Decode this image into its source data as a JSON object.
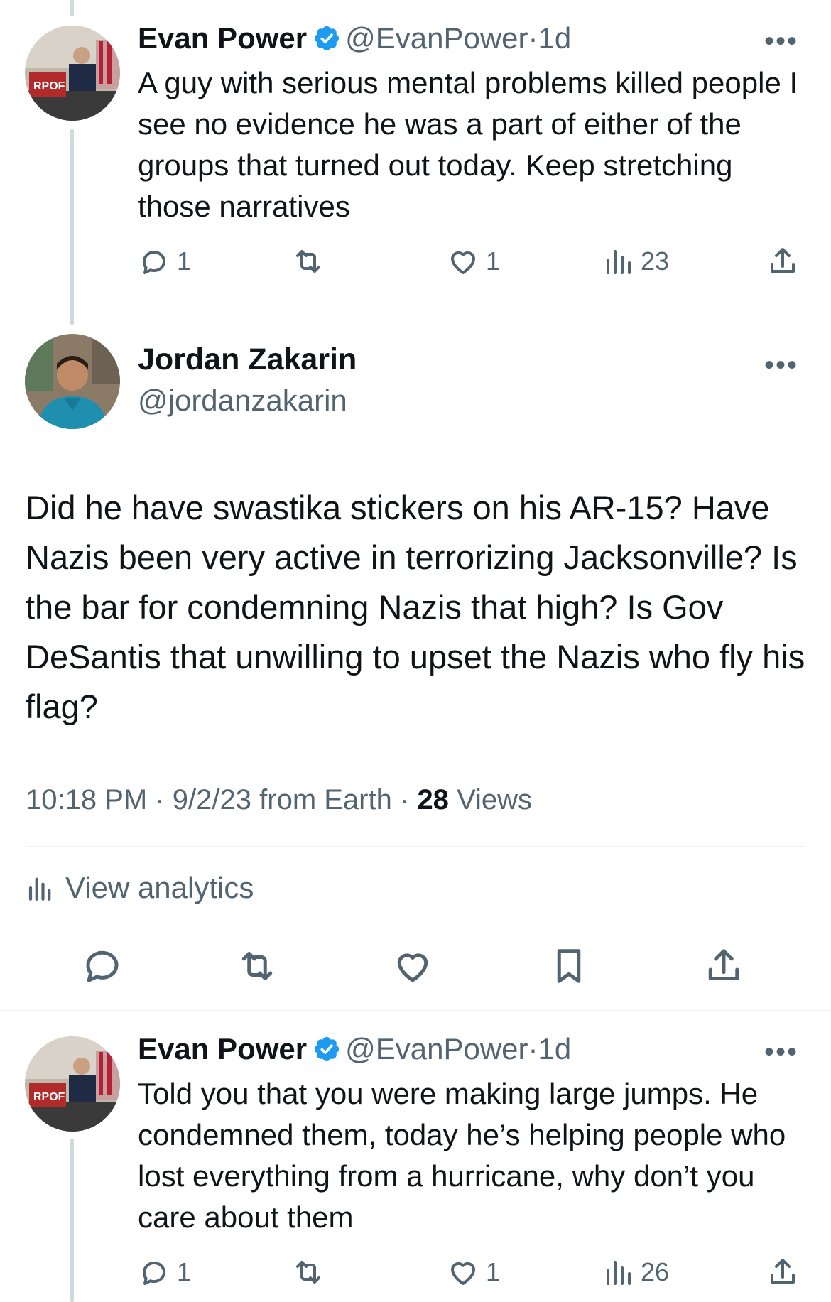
{
  "tweet1": {
    "name": "Evan Power",
    "handle": "@EvanPower",
    "separator": "·",
    "time": "1d",
    "text": "A guy with serious mental problems killed people I see no evidence he was a part of either of the groups that turned out today. Keep stretching those narratives",
    "replies": "1",
    "likes": "1",
    "views": "23"
  },
  "main_tweet": {
    "name": "Jordan Zakarin",
    "handle": "@jordanzakarin",
    "text": "Did he have swastika stickers on his AR-15? Have Nazis been very active in terrorizing Jacksonville? Is the bar for condemning Nazis that high? Is Gov DeSantis that unwilling to upset the Nazis who fly his flag?",
    "time": "10:18 PM",
    "date": "9/2/23",
    "source": "from Earth",
    "views_count": "28",
    "views_label": "Views",
    "separator": "·",
    "analytics_label": "View analytics"
  },
  "tweet2": {
    "name": "Evan Power",
    "handle": "@EvanPower",
    "separator": "·",
    "time": "1d",
    "text": "Told you that you were making large jumps. He condemned them, today he’s helping people who lost everything from a hurricane, why don’t you care about them",
    "replies": "1",
    "likes": "1",
    "views": "26"
  },
  "icons": {
    "verified": "verified-badge-icon",
    "reply": "reply-icon",
    "retweet": "retweet-icon",
    "like": "heart-icon",
    "views": "views-bar-chart-icon",
    "share": "share-icon",
    "bookmark": "bookmark-icon",
    "more": "more-dots-icon"
  },
  "colors": {
    "verified_blue": "#1d9bf0",
    "secondary_text": "#536471",
    "primary_text": "#0f1419",
    "thread_line": "#cfd9de"
  },
  "more_glyph": "•••"
}
